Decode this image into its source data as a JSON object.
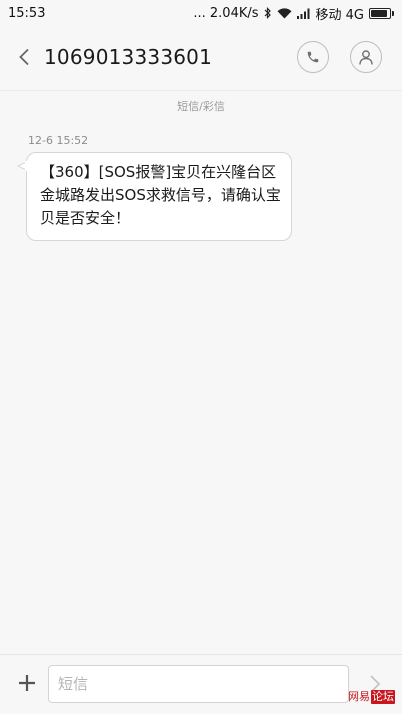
{
  "status_bar": {
    "time": "15:53",
    "network_speed": "... 2.04K/s",
    "carrier": "移动 4G",
    "battery_level": 0.9
  },
  "header": {
    "contact_number": "1069013333601"
  },
  "conversation": {
    "type_label": "短信/彩信",
    "messages": [
      {
        "timestamp": "12-6 15:52",
        "text": "【360】[SOS报警]宝贝在兴隆台区金城路发出SOS求救信号，请确认宝贝是否安全！"
      }
    ]
  },
  "input_bar": {
    "placeholder": "短信"
  },
  "watermark": {
    "part1": "网易",
    "part2": "论坛"
  },
  "colors": {
    "background": "#f7f7f7",
    "bubble": "#ffffff",
    "bubble_border": "#d6d6d6",
    "watermark_red": "#c8161d"
  }
}
